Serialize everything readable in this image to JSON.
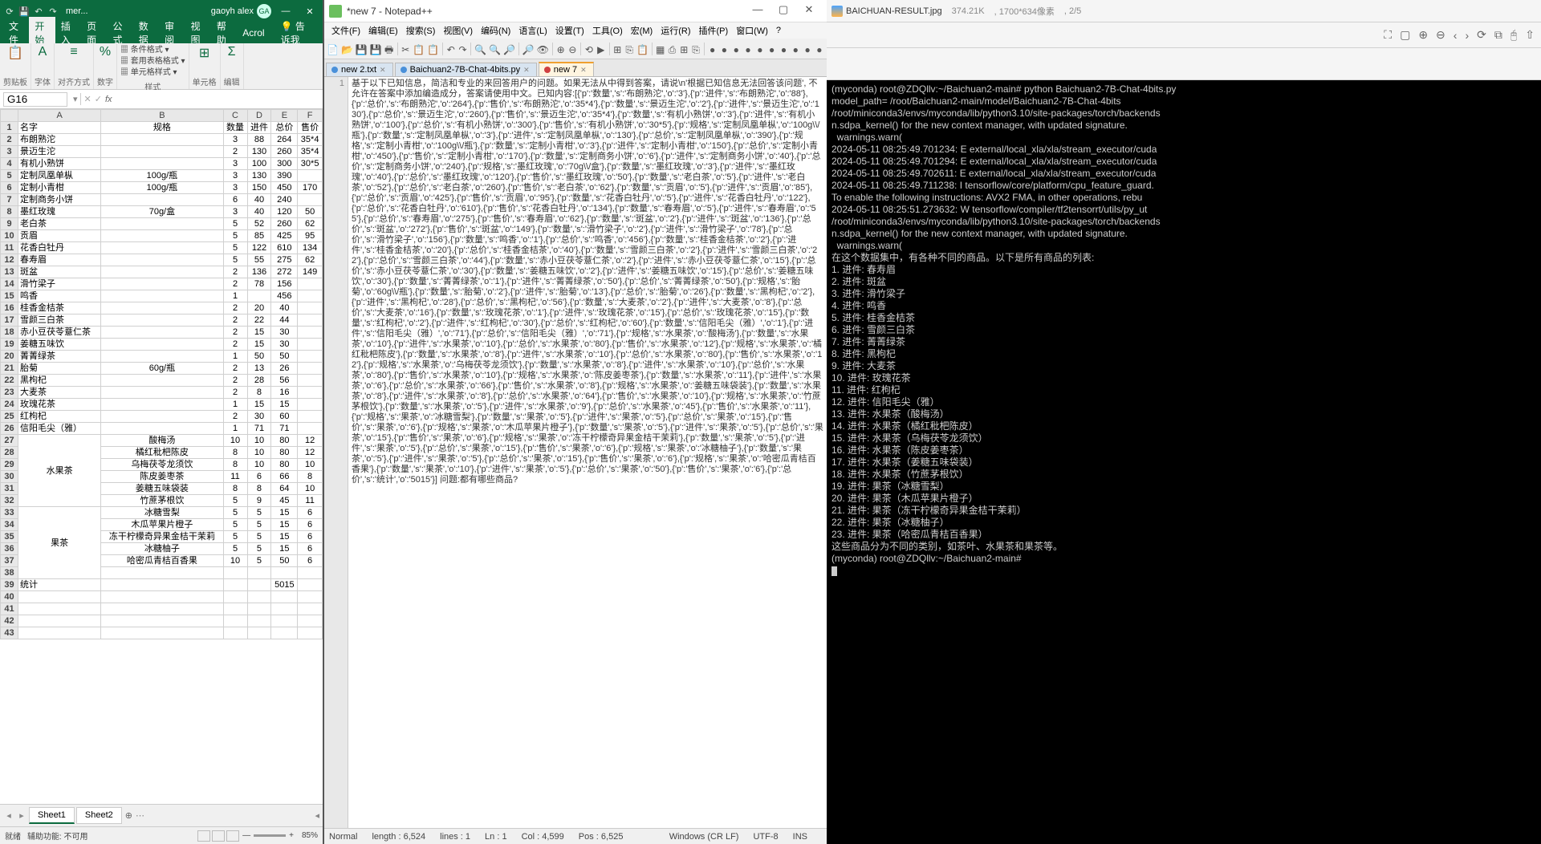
{
  "excel": {
    "doc_name": "mer...",
    "user_name": "gaoyh alex",
    "user_initials": "GA",
    "menu": [
      "文件",
      "开始",
      "插入",
      "页面",
      "公式",
      "数据",
      "审阅",
      "视图",
      "帮助",
      "Acrol"
    ],
    "menu_active": 1,
    "tell_me": "告诉我",
    "ribbon_groups": [
      {
        "icon": "📋",
        "label": "剪贴板"
      },
      {
        "icon": "A",
        "label": "字体"
      },
      {
        "icon": "≡",
        "label": "对齐方式"
      },
      {
        "icon": "%",
        "label": "数字"
      },
      {
        "icon": "",
        "label": "样式",
        "items": [
          "条件格式 ▾",
          "套用表格格式 ▾",
          "单元格样式 ▾"
        ]
      },
      {
        "icon": "⊞",
        "label": "单元格"
      },
      {
        "icon": "Σ",
        "label": "编辑"
      }
    ],
    "cell_ref": "G16",
    "columns": [
      "",
      "A",
      "B",
      "C",
      "D",
      "E",
      "F"
    ],
    "rows": [
      {
        "n": 1,
        "c": [
          "名字",
          "规格",
          "数量",
          "进件",
          "总价",
          "售价"
        ]
      },
      {
        "n": 2,
        "c": [
          "布朗熟沱",
          "",
          "3",
          "88",
          "264",
          "35*4"
        ]
      },
      {
        "n": 3,
        "c": [
          "景迈生沱",
          "",
          "2",
          "130",
          "260",
          "35*4"
        ]
      },
      {
        "n": 4,
        "c": [
          "有机小熟饼",
          "",
          "3",
          "100",
          "300",
          "30*5"
        ]
      },
      {
        "n": 5,
        "c": [
          "定制凤凰单枞",
          "100g/瓶",
          "3",
          "130",
          "390",
          ""
        ]
      },
      {
        "n": 6,
        "c": [
          "定制小青柑",
          "100g/瓶",
          "3",
          "150",
          "450",
          "170"
        ]
      },
      {
        "n": 7,
        "c": [
          "定制商务小饼",
          "",
          "6",
          "40",
          "240",
          ""
        ]
      },
      {
        "n": 8,
        "c": [
          "墨红玫瑰",
          "70g/盒",
          "3",
          "40",
          "120",
          "50"
        ]
      },
      {
        "n": 9,
        "c": [
          "老白茶",
          "",
          "5",
          "52",
          "260",
          "62"
        ]
      },
      {
        "n": 10,
        "c": [
          "贡眉",
          "",
          "5",
          "85",
          "425",
          "95"
        ]
      },
      {
        "n": 11,
        "c": [
          "花香白牡丹",
          "",
          "5",
          "122",
          "610",
          "134"
        ]
      },
      {
        "n": 12,
        "c": [
          "春寿眉",
          "",
          "5",
          "55",
          "275",
          "62"
        ]
      },
      {
        "n": 13,
        "c": [
          "斑盆",
          "",
          "2",
          "136",
          "272",
          "149"
        ]
      },
      {
        "n": 14,
        "c": [
          "滑竹梁子",
          "",
          "2",
          "78",
          "156",
          ""
        ]
      },
      {
        "n": 15,
        "c": [
          "鸣香",
          "",
          "1",
          "",
          "456",
          ""
        ]
      },
      {
        "n": 16,
        "c": [
          "桂香金桔茶",
          "",
          "2",
          "20",
          "40",
          ""
        ]
      },
      {
        "n": 17,
        "c": [
          "雪颜三白茶",
          "",
          "2",
          "22",
          "44",
          ""
        ]
      },
      {
        "n": 18,
        "c": [
          "赤小豆茯苓薏仁茶",
          "",
          "2",
          "15",
          "30",
          ""
        ]
      },
      {
        "n": 19,
        "c": [
          "姜糖五味饮",
          "",
          "2",
          "15",
          "30",
          ""
        ]
      },
      {
        "n": 20,
        "c": [
          "菁菁绿茶",
          "",
          "1",
          "50",
          "50",
          ""
        ]
      },
      {
        "n": 21,
        "c": [
          "胎菊",
          "60g/瓶",
          "2",
          "13",
          "26",
          ""
        ]
      },
      {
        "n": 22,
        "c": [
          "黑枸杞",
          "",
          "2",
          "28",
          "56",
          ""
        ]
      },
      {
        "n": 23,
        "c": [
          "大麦茶",
          "",
          "2",
          "8",
          "16",
          ""
        ]
      },
      {
        "n": 24,
        "c": [
          "玫瑰花茶",
          "",
          "1",
          "15",
          "15",
          ""
        ]
      },
      {
        "n": 25,
        "c": [
          "红枸杞",
          "",
          "2",
          "30",
          "60",
          ""
        ]
      },
      {
        "n": 26,
        "c": [
          "信阳毛尖（雅）",
          "",
          "1",
          "71",
          "71",
          ""
        ]
      },
      {
        "n": 27,
        "m": "水果茶",
        "c": [
          "",
          "酸梅汤",
          "10",
          "10",
          "80",
          "12"
        ]
      },
      {
        "n": 28,
        "c": [
          "",
          "橘红秕杷陈皮",
          "8",
          "10",
          "80",
          "12"
        ]
      },
      {
        "n": 29,
        "c": [
          "",
          "乌梅茯苓龙须饮",
          "8",
          "10",
          "80",
          "10"
        ]
      },
      {
        "n": 30,
        "c": [
          "",
          "陈皮姜枣茶",
          "11",
          "6",
          "66",
          "8"
        ]
      },
      {
        "n": 31,
        "c": [
          "",
          "姜糖五味袋装",
          "8",
          "8",
          "64",
          "10"
        ]
      },
      {
        "n": 32,
        "c": [
          "",
          "竹蔗茅根饮",
          "5",
          "9",
          "45",
          "11"
        ]
      },
      {
        "n": 33,
        "m": "果茶",
        "c": [
          "",
          "冰糖雪梨",
          "5",
          "5",
          "15",
          "6"
        ]
      },
      {
        "n": 34,
        "c": [
          "",
          "木瓜苹果片橙子",
          "5",
          "5",
          "15",
          "6"
        ]
      },
      {
        "n": 35,
        "c": [
          "",
          "冻干柠檬奇异果金桔干茉莉",
          "5",
          "5",
          "15",
          "6"
        ]
      },
      {
        "n": 36,
        "c": [
          "",
          "冰糖柚子",
          "5",
          "5",
          "15",
          "6"
        ]
      },
      {
        "n": 37,
        "c": [
          "",
          "哈密瓜青桔百香果",
          "10",
          "5",
          "50",
          "6"
        ]
      },
      {
        "n": 38,
        "c": [
          "",
          "",
          "",
          "",
          "",
          ""
        ]
      },
      {
        "n": 39,
        "c": [
          "统计",
          "",
          "",
          "",
          "5015",
          ""
        ]
      },
      {
        "n": 40,
        "c": [
          "",
          "",
          "",
          "",
          "",
          ""
        ]
      },
      {
        "n": 41,
        "c": [
          "",
          "",
          "",
          "",
          "",
          ""
        ]
      },
      {
        "n": 42,
        "c": [
          "",
          "",
          "",
          "",
          "",
          ""
        ]
      },
      {
        "n": 43,
        "c": [
          "",
          "",
          "",
          "",
          "",
          ""
        ]
      }
    ],
    "sheets": [
      "Sheet1",
      "Sheet2"
    ],
    "sheet_active": 0,
    "status_left": "就绪",
    "status_access": "辅助功能: 不可用",
    "zoom": "85%"
  },
  "npp": {
    "title": "*new 7 - Notepad++",
    "menu": [
      "文件(F)",
      "编辑(E)",
      "搜索(S)",
      "视图(V)",
      "编码(N)",
      "语言(L)",
      "设置(T)",
      "工具(O)",
      "宏(M)",
      "运行(R)",
      "插件(P)",
      "窗口(W)",
      "?"
    ],
    "tabs": [
      {
        "label": "new 2.txt",
        "active": false,
        "close": "✕"
      },
      {
        "label": "Baichuan2-7B-Chat-4bits.py",
        "active": false,
        "close": "✕"
      },
      {
        "label": "new 7",
        "active": true,
        "close": "✕"
      }
    ],
    "line_no": "1",
    "code": "基于以下已知信息，简洁和专业的来回答用户的问题。如果无法从中得到答案，请说\\n'根据已知信息无法回答该问题', 不允许在答案中添加编造成分，答案请使用中文。已知内容:[{'p':'数量','s':'布朗熟沱','o':'3'},{'p':'进件','s':'布朗熟沱','o':'88'},{'p':'总价','s':'布朗熟沱','o':'264'},{'p':'售价','s':'布朗熟沱','o':'35*4'},{'p':'数量','s':'景迈生沱','o':'2'},{'p':'进件','s':'景迈生沱','o':'130'},{'p':'总价','s':'景迈生沱','o':'260'},{'p':'售价','s':'景迈生沱','o':'35*4'},{'p':'数量','s':'有机小熟饼','o':'3'},{'p':'进件','s':'有机小熟饼','o':'100'},{'p':'总价','s':'有机小熟饼','o':'300'},{'p':'售价','s':'有机小熟饼','o':'30*5'},{'p':'规格','s':'定制凤凰单枞','o':'100g\\\\/瓶'},{'p':'数量','s':'定制凤凰单枞','o':'3'},{'p':'进件','s':'定制凤凰单枞','o':'130'},{'p':'总价','s':'定制凤凰单枞','o':'390'},{'p':'规格','s':'定制小青柑','o':'100g\\\\/瓶'},{'p':'数量','s':'定制小青柑','o':'3'},{'p':'进件','s':'定制小青柑','o':'150'},{'p':'总价','s':'定制小青柑','o':'450'},{'p':'售价','s':'定制小青柑','o':'170'},{'p':'数量','s':'定制商务小饼','o':'6'},{'p':'进件','s':'定制商务小饼','o':'40'},{'p':'总价','s':'定制商务小饼','o':'240'},{'p':'规格','s':'墨红玫瑰','o':'70g\\\\/盒'},{'p':'数量','s':'墨红玫瑰','o':'3'},{'p':'进件','s':'墨红玫瑰','o':'40'},{'p':'总价','s':'墨红玫瑰','o':'120'},{'p':'售价','s':'墨红玫瑰','o':'50'},{'p':'数量','s':'老白茶','o':'5'},{'p':'进件','s':'老白茶','o':'52'},{'p':'总价','s':'老白茶','o':'260'},{'p':'售价','s':'老白茶','o':'62'},{'p':'数量','s':'贡眉','o':'5'},{'p':'进件','s':'贡眉','o':'85'},{'p':'总价','s':'贡眉','o':'425'},{'p':'售价','s':'贡眉','o':'95'},{'p':'数量','s':'花香白牡丹','o':'5'},{'p':'进件','s':'花香白牡丹','o':'122'},{'p':'总价','s':'花香白牡丹','o':'610'},{'p':'售价','s':'花香白牡丹','o':'134'},{'p':'数量','s':'春寿眉','o':'5'},{'p':'进件','s':'春寿眉','o':'55'},{'p':'总价','s':'春寿眉','o':'275'},{'p':'售价','s':'春寿眉','o':'62'},{'p':'数量','s':'斑盆','o':'2'},{'p':'进件','s':'斑盆','o':'136'},{'p':'总价','s':'斑盆','o':'272'},{'p':'售价','s':'斑盆','o':'149'},{'p':'数量','s':'滑竹梁子','o':'2'},{'p':'进件','s':'滑竹梁子','o':'78'},{'p':'总价','s':'滑竹梁子','o':'156'},{'p':'数量','s':'鸣香','o':'1'},{'p':'总价','s':'鸣香','o':'456'},{'p':'数量','s':'桂香金桔茶','o':'2'},{'p':'进件','s':'桂香金桔茶','o':'20'},{'p':'总价','s':'桂香金桔茶','o':'40'},{'p':'数量','s':'雪颜三白茶','o':'2'},{'p':'进件','s':'雪颜三白茶','o':'22'},{'p':'总价','s':'雪颜三白茶','o':'44'},{'p':'数量','s':'赤小豆茯苓薏仁茶','o':'2'},{'p':'进件','s':'赤小豆茯苓薏仁茶','o':'15'},{'p':'总价','s':'赤小豆茯苓薏仁茶','o':'30'},{'p':'数量','s':'姜糖五味饮','o':'2'},{'p':'进件','s':'姜糖五味饮','o':'15'},{'p':'总价','s':'姜糖五味饮','o':'30'},{'p':'数量','s':'菁菁绿茶','o':'1'},{'p':'进件','s':'菁菁绿茶','o':'50'},{'p':'总价','s':'菁菁绿茶','o':'50'},{'p':'规格','s':'胎菊','o':'60g\\\\/瓶'},{'p':'数量','s':'胎菊','o':'2'},{'p':'进件','s':'胎菊','o':'13'},{'p':'总价','s':'胎菊','o':'26'},{'p':'数量','s':'黑枸杞','o':'2'},{'p':'进件','s':'黑枸杞','o':'28'},{'p':'总价','s':'黑枸杞','o':'56'},{'p':'数量','s':'大麦茶','o':'2'},{'p':'进件','s':'大麦茶','o':'8'},{'p':'总价','s':'大麦茶','o':'16'},{'p':'数量','s':'玫瑰花茶','o':'1'},{'p':'进件','s':'玫瑰花茶','o':'15'},{'p':'总价','s':'玫瑰花茶','o':'15'},{'p':'数量','s':'红枸杞','o':'2'},{'p':'进件','s':'红枸杞','o':'30'},{'p':'总价','s':'红枸杞','o':'60'},{'p':'数量','s':'信阳毛尖（雅）','o':'1'},{'p':'进件','s':'信阳毛尖（雅）','o':'71'},{'p':'总价','s':'信阳毛尖（雅）','o':'71'},{'p':'规格','s':'水果茶','o':'酸梅汤'},{'p':'数量','s':'水果茶','o':'10'},{'p':'进件','s':'水果茶','o':'10'},{'p':'总价','s':'水果茶','o':'80'},{'p':'售价','s':'水果茶','o':'12'},{'p':'规格','s':'水果茶','o':'橘红秕杷陈皮'},{'p':'数量','s':'水果茶','o':'8'},{'p':'进件','s':'水果茶','o':'10'},{'p':'总价','s':'水果茶','o':'80'},{'p':'售价','s':'水果茶','o':'12'},{'p':'规格','s':'水果茶','o':'乌梅茯苓龙须饮'},{'p':'数量','s':'水果茶','o':'8'},{'p':'进件','s':'水果茶','o':'10'},{'p':'总价','s':'水果茶','o':'80'},{'p':'售价','s':'水果茶','o':'10'},{'p':'规格','s':'水果茶','o':'陈皮姜枣茶'},{'p':'数量','s':'水果茶','o':'11'},{'p':'进件','s':'水果茶','o':'6'},{'p':'总价','s':'水果茶','o':'66'},{'p':'售价','s':'水果茶','o':'8'},{'p':'规格','s':'水果茶','o':'姜糖五味袋装'},{'p':'数量','s':'水果茶','o':'8'},{'p':'进件','s':'水果茶','o':'8'},{'p':'总价','s':'水果茶','o':'64'},{'p':'售价','s':'水果茶','o':'10'},{'p':'规格','s':'水果茶','o':'竹蔗茅根饮'},{'p':'数量','s':'水果茶','o':'5'},{'p':'进件','s':'水果茶','o':'9'},{'p':'总价','s':'水果茶','o':'45'},{'p':'售价','s':'水果茶','o':'11'},{'p':'规格','s':'果茶','o':'冰糖雪梨'},{'p':'数量','s':'果茶','o':'5'},{'p':'进件','s':'果茶','o':'5'},{'p':'总价','s':'果茶','o':'15'},{'p':'售价','s':'果茶','o':'6'},{'p':'规格','s':'果茶','o':'木瓜苹果片橙子'},{'p':'数量','s':'果茶','o':'5'},{'p':'进件','s':'果茶','o':'5'},{'p':'总价','s':'果茶','o':'15'},{'p':'售价','s':'果茶','o':'6'},{'p':'规格','s':'果茶','o':'冻干柠檬奇异果金桔干茉莉'},{'p':'数量','s':'果茶','o':'5'},{'p':'进件','s':'果茶','o':'5'},{'p':'总价','s':'果茶','o':'15'},{'p':'售价','s':'果茶','o':'6'},{'p':'规格','s':'果茶','o':'冰糖柚子'},{'p':'数量','s':'果茶','o':'5'},{'p':'进件','s':'果茶','o':'5'},{'p':'总价','s':'果茶','o':'15'},{'p':'售价','s':'果茶','o':'6'},{'p':'规格','s':'果茶','o':'哈密瓜青桔百香果'},{'p':'数量','s':'果茶','o':'10'},{'p':'进件','s':'果茶','o':'5'},{'p':'总价','s':'果茶','o':'50'},{'p':'售价','s':'果茶','o':'6'},{'p':'总价','s':'统计','o':'5015'}] 问题:都有哪些商品?",
    "status": {
      "lang": "Normal",
      "length": "length : 6,524",
      "lines": "lines : 1",
      "ln": "Ln : 1",
      "col": "Col : 4,599",
      "pos": "Pos : 6,525",
      "eol": "Windows (CR LF)",
      "enc": "UTF-8",
      "ins": "INS"
    }
  },
  "viewer": {
    "filename": "BAICHUAN-RESULT.jpg",
    "size": "374.21K",
    "dims": "1700*634像素",
    "index": "2/5",
    "terminal_lines": [
      "(myconda) root@ZDQllv:~/Baichuan2-main# python Baichuan2-7B-Chat-4bits.py",
      "model_path= /root/Baichuan2-main/model/Baichuan2-7B-Chat-4bits",
      "/root/miniconda3/envs/myconda/lib/python3.10/site-packages/torch/backends",
      "n.sdpa_kernel() for the new context manager, with updated signature.",
      "  warnings.warn(",
      "2024-05-11 08:25:49.701234: E external/local_xla/xla/stream_executor/cuda",
      "2024-05-11 08:25:49.701294: E external/local_xla/xla/stream_executor/cuda",
      "2024-05-11 08:25:49.702611: E external/local_xla/xla/stream_executor/cuda",
      "2024-05-11 08:25:49.711238: I tensorflow/core/platform/cpu_feature_guard.",
      "To enable the following instructions: AVX2 FMA, in other operations, rebu",
      "2024-05-11 08:25:51.273632: W tensorflow/compiler/tf2tensorrt/utils/py_ut",
      "/root/miniconda3/envs/myconda/lib/python3.10/site-packages/torch/backends",
      "n.sdpa_kernel() for the new context manager, with updated signature.",
      "  warnings.warn(",
      "在这个数据集中，有各种不同的商品。以下是所有商品的列表:",
      "",
      "1. 进件: 春寿眉",
      "2. 进件: 斑盆",
      "3. 进件: 滑竹梁子",
      "4. 进件: 鸣香",
      "5. 进件: 桂香金桔茶",
      "6. 进件: 雪颜三白茶",
      "7. 进件: 菁菁绿茶",
      "8. 进件: 黑枸杞",
      "9. 进件: 大麦茶",
      "10. 进件: 玫瑰花茶",
      "11. 进件: 红枸杞",
      "12. 进件: 信阳毛尖（雅）",
      "13. 进件: 水果茶（酸梅汤）",
      "14. 进件: 水果茶（橘红秕杷陈皮）",
      "15. 进件: 水果茶（乌梅茯苓龙须饮）",
      "16. 进件: 水果茶（陈皮姜枣茶）",
      "17. 进件: 水果茶（姜糖五味袋装）",
      "18. 进件: 水果茶（竹蔗茅根饮）",
      "19. 进件: 果茶（冰糖雪梨）",
      "20. 进件: 果茶（木瓜苹果片橙子）",
      "21. 进件: 果茶（冻干柠檬奇异果金桔干茉莉）",
      "22. 进件: 果茶（冰糖柚子）",
      "23. 进件: 果茶（哈密瓜青桔百香果）",
      "",
      "这些商品分为不同的类别，如茶叶、水果茶和果茶等。",
      "(myconda) root@ZDQllv:~/Baichuan2-main#"
    ]
  }
}
